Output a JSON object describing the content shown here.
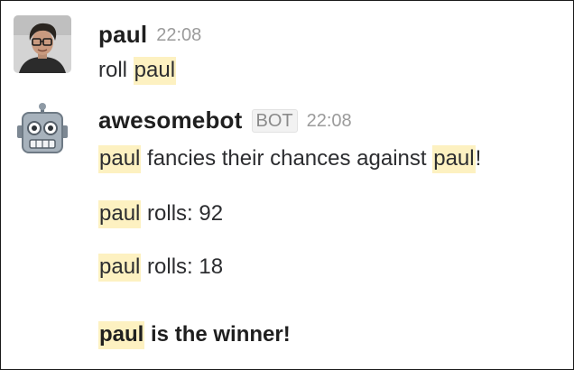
{
  "messages": [
    {
      "author": "paul",
      "time": "22:08",
      "lines": [
        {
          "pre": "roll ",
          "mention": "paul"
        }
      ]
    },
    {
      "author": "awesomebot",
      "badge": "BOT",
      "time": "22:08",
      "lines": [
        {
          "mention": "paul",
          "middle": " fancies their chances against ",
          "mention2": "paul",
          "post": "!"
        },
        {
          "mention": "paul",
          "post": " rolls: 92"
        },
        {
          "mention": "paul",
          "post": " rolls: 18"
        },
        {
          "mention": "paul",
          "post": " is the winner!"
        }
      ]
    }
  ],
  "colors": {
    "mention_highlight": "#fdf1c1",
    "author_text": "#1f1f1f",
    "timestamp": "#9b9b9b"
  },
  "icons": {
    "user_avatar": "person-photo-avatar",
    "bot_avatar": "robot-face-avatar"
  }
}
